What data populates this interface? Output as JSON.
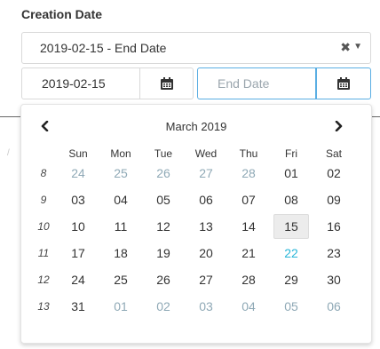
{
  "section_label": "Creation Date",
  "range_select": {
    "value": "2019-02-15 - End Date",
    "clear_glyph": "✖",
    "caret_glyph": "▼"
  },
  "start_input": {
    "value": "2019-02-15",
    "placeholder": ""
  },
  "end_input": {
    "value": "",
    "placeholder": "End Date"
  },
  "icons": {
    "calendar": "calendar-icon",
    "prev": "chevron-left-icon",
    "next": "chevron-right-icon"
  },
  "calendar": {
    "month_title": "March 2019",
    "weekdays": [
      "Sun",
      "Mon",
      "Tue",
      "Wed",
      "Thu",
      "Fri",
      "Sat"
    ],
    "weeks": [
      {
        "week": "8",
        "days": [
          "24",
          "25",
          "26",
          "27",
          "28",
          "01",
          "02"
        ]
      },
      {
        "week": "9",
        "days": [
          "03",
          "04",
          "05",
          "06",
          "07",
          "08",
          "09"
        ]
      },
      {
        "week": "10",
        "days": [
          "10",
          "11",
          "12",
          "13",
          "14",
          "15",
          "16"
        ]
      },
      {
        "week": "11",
        "days": [
          "17",
          "18",
          "19",
          "20",
          "21",
          "22",
          "23"
        ]
      },
      {
        "week": "12",
        "days": [
          "24",
          "25",
          "26",
          "27",
          "28",
          "29",
          "30"
        ]
      },
      {
        "week": "13",
        "days": [
          "31",
          "01",
          "02",
          "03",
          "04",
          "05",
          "06"
        ]
      }
    ]
  },
  "colors": {
    "accent": "#5aaee3",
    "today": "#29b6d8",
    "other_month": "#8fa9b6",
    "selected_bg": "#ececec"
  }
}
